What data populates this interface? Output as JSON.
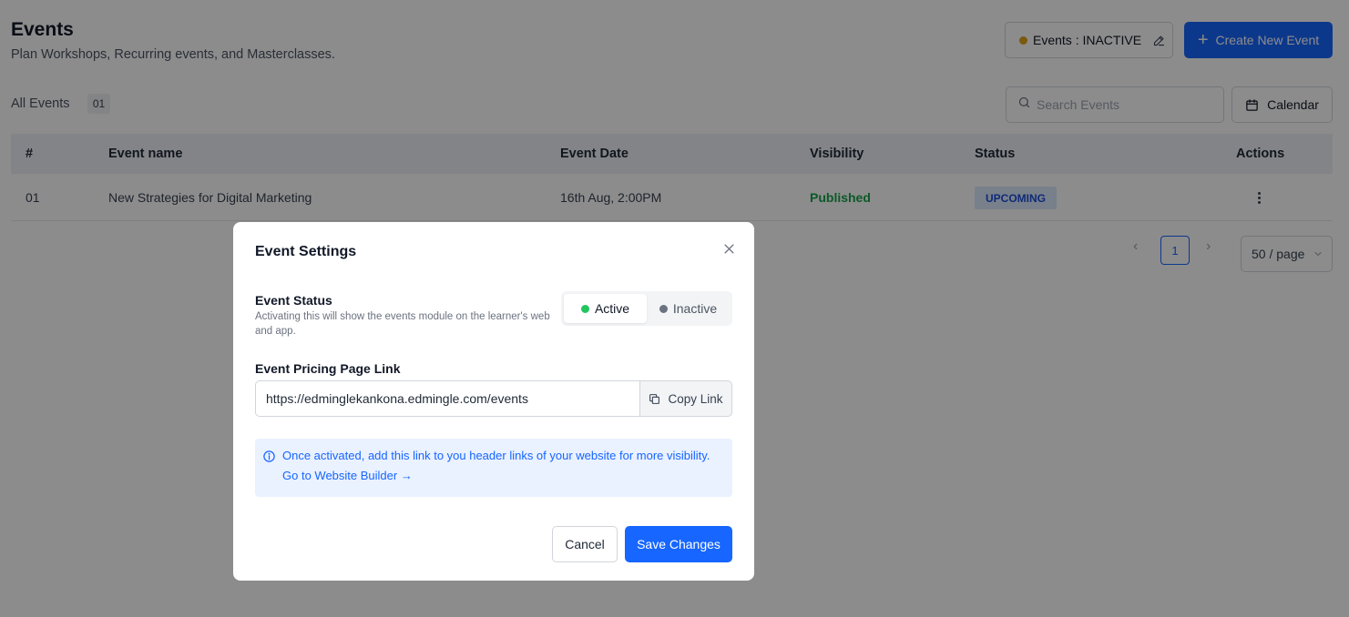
{
  "header": {
    "title": "Events",
    "subtitle": "Plan Workshops, Recurring events, and Masterclasses.",
    "status_pill_label": "Events : INACTIVE",
    "status_dot_color": "#e0a21a",
    "create_label": "Create New Event"
  },
  "toolbar": {
    "all_events_label": "All Events",
    "count": "01",
    "search_placeholder": "Search Events",
    "calendar_label": "Calendar"
  },
  "table": {
    "columns": [
      "#",
      "Event name",
      "Event Date",
      "Visibility",
      "Status",
      "Actions"
    ],
    "rows": [
      {
        "num": "01",
        "name": "New Strategies for Digital Marketing",
        "date": "16th Aug, 2:00PM",
        "visibility": "Published",
        "status": "UPCOMING"
      }
    ]
  },
  "pagination": {
    "prev": "‹",
    "current": "1",
    "next": "›",
    "page_size": "50 / page"
  },
  "modal": {
    "title": "Event Settings",
    "status_label": "Event Status",
    "status_help": "Activating this will show the events module on the learner's web and app.",
    "active_label": "Active",
    "inactive_label": "Inactive",
    "active_color": "#22c55e",
    "inactive_color": "#6b7280",
    "link_label": "Event Pricing Page Link",
    "link_value": "https://edminglekankona.edmingle.com/events",
    "copy_label": "Copy Link",
    "info_text": "Once activated, add this link to you header links of your website for more visibility.",
    "info_link": "Go to Website Builder →",
    "cancel_label": "Cancel",
    "save_label": "Save Changes"
  },
  "colors": {
    "primary": "#1766ff",
    "published": "#16a34a",
    "upcoming_bg": "#dbeafe"
  }
}
